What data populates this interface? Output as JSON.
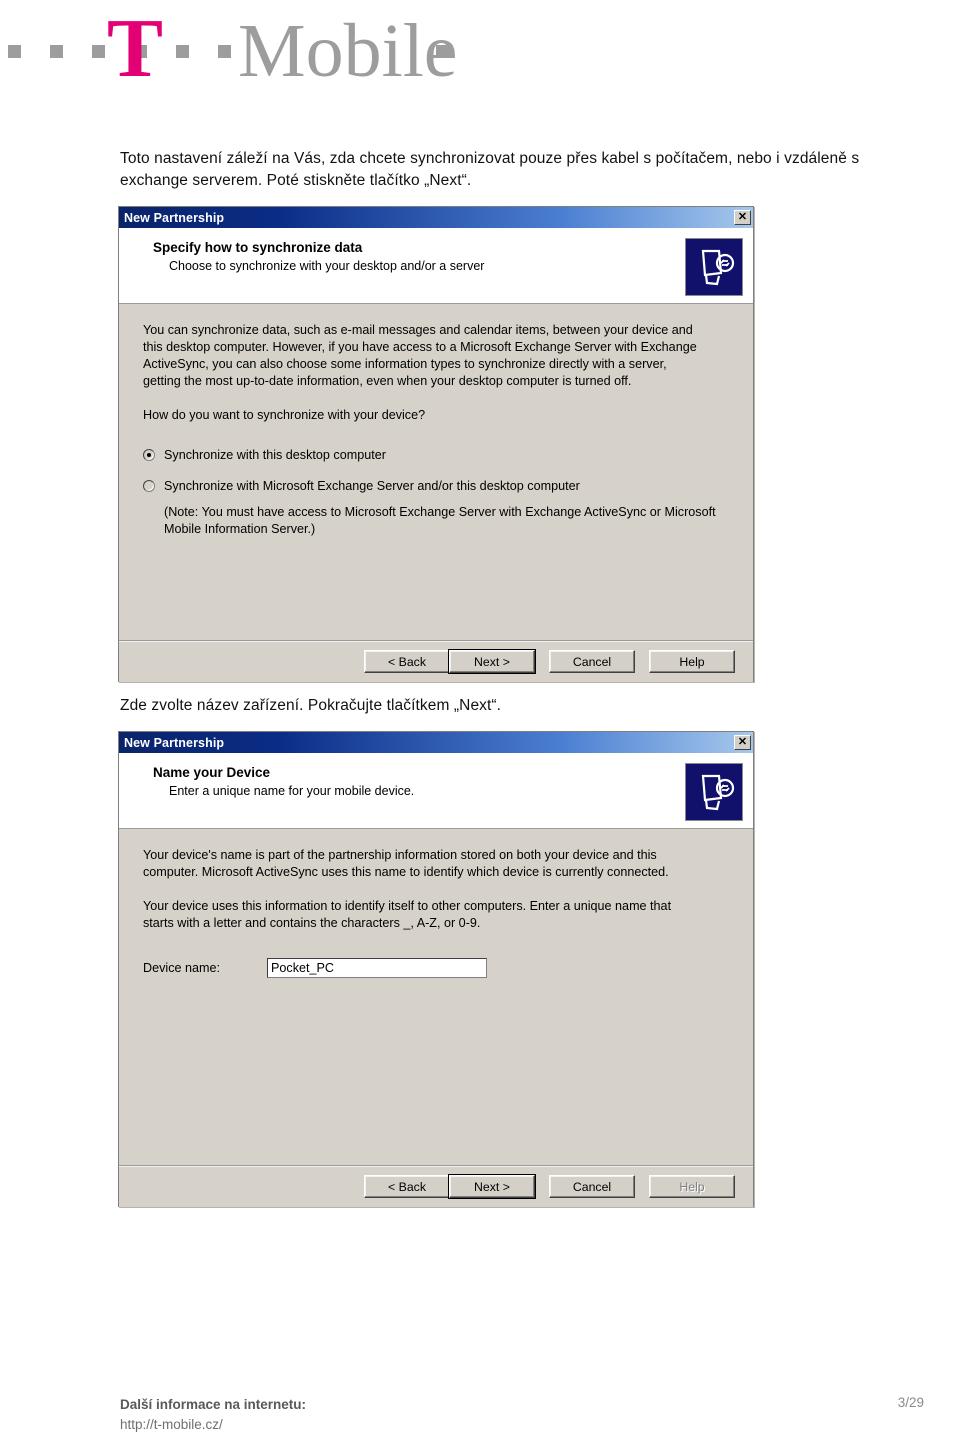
{
  "brand": {
    "name": "T-Mobile",
    "t_letter": "T",
    "word": "Mobile",
    "magenta": "#e20074",
    "gray": "#9d9d9d"
  },
  "instructions": {
    "first": "Toto nastavení záleží na Vás, zda chcete synchronizovat pouze přes kabel s počítačem, nebo i vzdáleně s exchange serverem. Poté stiskněte tlačítko „Next“.",
    "second": "Zde zvolte název zařízení. Pokračujte tlačítkem „Next“."
  },
  "dialog_sync": {
    "titlebar": "New Partnership",
    "close_label": "✕",
    "heading": "Specify how to synchronize data",
    "subheading": "Choose to synchronize with your desktop and/or a server",
    "paragraph_1": "You can synchronize data, such as e-mail messages and calendar items, between your device and this desktop computer.  However, if you have access to a Microsoft Exchange Server with Exchange ActiveSync, you can also choose some information types to synchronize directly with a server, getting the most up-to-date information, even when your desktop computer is turned off.",
    "paragraph_2": "How do you want to synchronize with your device?",
    "option_1": "Synchronize with this desktop computer",
    "option_2": "Synchronize with Microsoft Exchange Server and/or this desktop computer",
    "option_2_note": "(Note: You must have access to Microsoft Exchange Server with Exchange ActiveSync or Microsoft Mobile Information Server.)",
    "buttons": {
      "back": "< Back",
      "next": "Next >",
      "cancel": "Cancel",
      "help": "Help"
    }
  },
  "dialog_name": {
    "titlebar": "New Partnership",
    "close_label": "✕",
    "heading": "Name your Device",
    "subheading": "Enter a unique name for your mobile device.",
    "paragraph_1": "Your device's name is part of the partnership information stored on both your device and this computer. Microsoft ActiveSync uses this name to identify which device is currently connected.",
    "paragraph_2": "Your device uses this information to identify itself to other computers. Enter a unique name that starts with a letter and contains the characters _, A-Z, or 0-9.",
    "field_label": "Device name:",
    "field_value": "Pocket_PC",
    "buttons": {
      "back": "< Back",
      "next": "Next >",
      "cancel": "Cancel",
      "help": "Help"
    }
  },
  "footer": {
    "info_label": "Další informace na internetu:",
    "url": "http://t-mobile.cz/",
    "page": "3/29"
  }
}
